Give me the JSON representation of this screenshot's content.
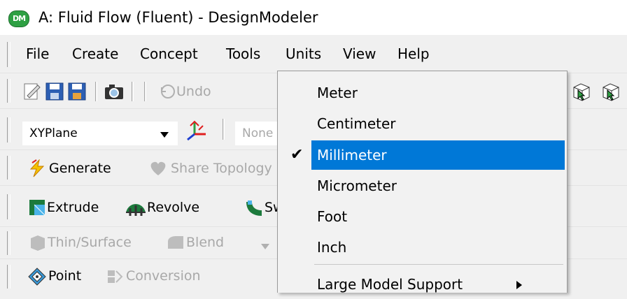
{
  "window": {
    "app_icon_text": "DM",
    "title": "A: Fluid Flow (Fluent) - DesignModeler"
  },
  "menubar": {
    "items": [
      "File",
      "Create",
      "Concept",
      "Tools",
      "Units",
      "View",
      "Help"
    ],
    "open": "Units"
  },
  "toolbar1": {
    "undo_label": "Undo"
  },
  "toolbar2": {
    "plane_value": "XYPlane",
    "sketch_value": "None"
  },
  "toolbar3": {
    "generate_label": "Generate",
    "share_topology_label": "Share Topology"
  },
  "toolbar4": {
    "extrude_label": "Extrude",
    "revolve_label": "Revolve",
    "sweep_label": "Sweep"
  },
  "toolbar5": {
    "thin_surface_label": "Thin/Surface",
    "blend_label": "Blend"
  },
  "toolbar6": {
    "point_label": "Point",
    "conversion_label": "Conversion"
  },
  "units_menu": {
    "items": [
      {
        "label": "Meter",
        "checked": false
      },
      {
        "label": "Centimeter",
        "checked": false
      },
      {
        "label": "Millimeter",
        "checked": true
      },
      {
        "label": "Micrometer",
        "checked": false
      },
      {
        "label": "Foot",
        "checked": false
      },
      {
        "label": "Inch",
        "checked": false
      }
    ],
    "submenu_item": "Large Model Support",
    "highlight_color": "#0078d7"
  }
}
